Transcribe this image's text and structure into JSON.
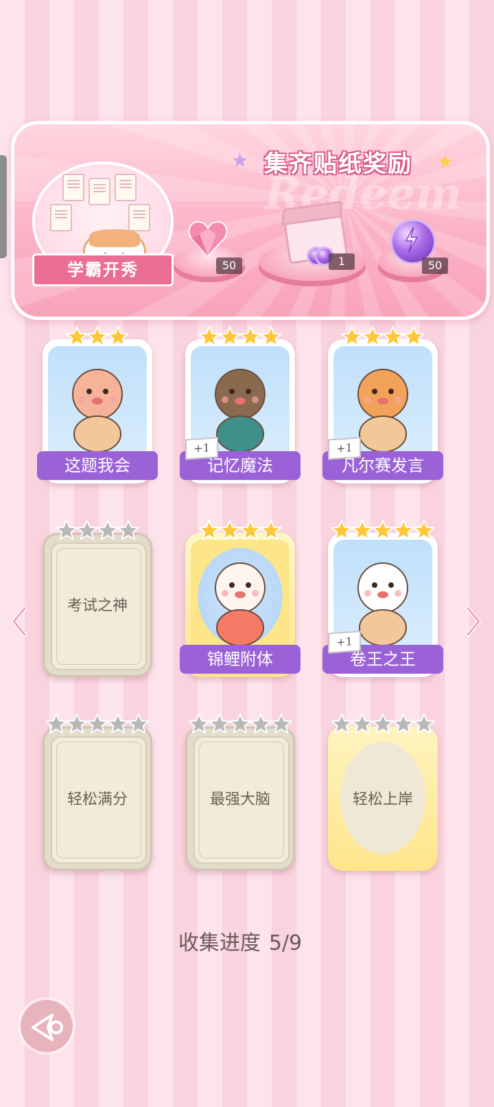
{
  "banner": {
    "title": "集齐贴纸奖励",
    "watermark": "Redeem",
    "badge_label": "学霸开秀",
    "rewards": [
      {
        "icon": "heart-gem-icon",
        "count": "50"
      },
      {
        "icon": "gift-box-icon",
        "count": "1"
      },
      {
        "icon": "energy-orb-icon",
        "count": "50"
      }
    ]
  },
  "stickers": [
    {
      "name": "这题我会",
      "stars": 3,
      "max_stars": 3,
      "owned": true,
      "extra": "",
      "art": "bear-at-desk"
    },
    {
      "name": "记忆魔法",
      "stars": 4,
      "max_stars": 4,
      "owned": true,
      "extra": "+1",
      "art": "otter-wizard"
    },
    {
      "name": "凡尔赛发言",
      "stars": 4,
      "max_stars": 4,
      "owned": true,
      "extra": "+1",
      "art": "lion-microphone"
    },
    {
      "name": "考试之神",
      "stars": 0,
      "max_stars": 4,
      "owned": false,
      "extra": "",
      "art": "locked"
    },
    {
      "name": "锦鲤附体",
      "stars": 4,
      "max_stars": 4,
      "owned": true,
      "extra": "",
      "art": "bear-koi"
    },
    {
      "name": "卷王之王",
      "stars": 5,
      "max_stars": 5,
      "owned": true,
      "extra": "+1",
      "art": "cat-studying"
    },
    {
      "name": "轻松满分",
      "stars": 0,
      "max_stars": 5,
      "owned": false,
      "extra": "",
      "art": "locked"
    },
    {
      "name": "最强大脑",
      "stars": 0,
      "max_stars": 5,
      "owned": false,
      "extra": "",
      "art": "locked"
    },
    {
      "name": "轻松上岸",
      "stars": 0,
      "max_stars": 5,
      "owned": false,
      "extra": "",
      "art": "locked-gold"
    }
  ],
  "progress": {
    "label": "收集进度",
    "value": "5/9"
  },
  "colors": {
    "label_purple": "#9b62d8",
    "star_gold": "#ffc83a",
    "star_gray": "#b8b8b8",
    "pink_bg": "#fde3ea"
  }
}
